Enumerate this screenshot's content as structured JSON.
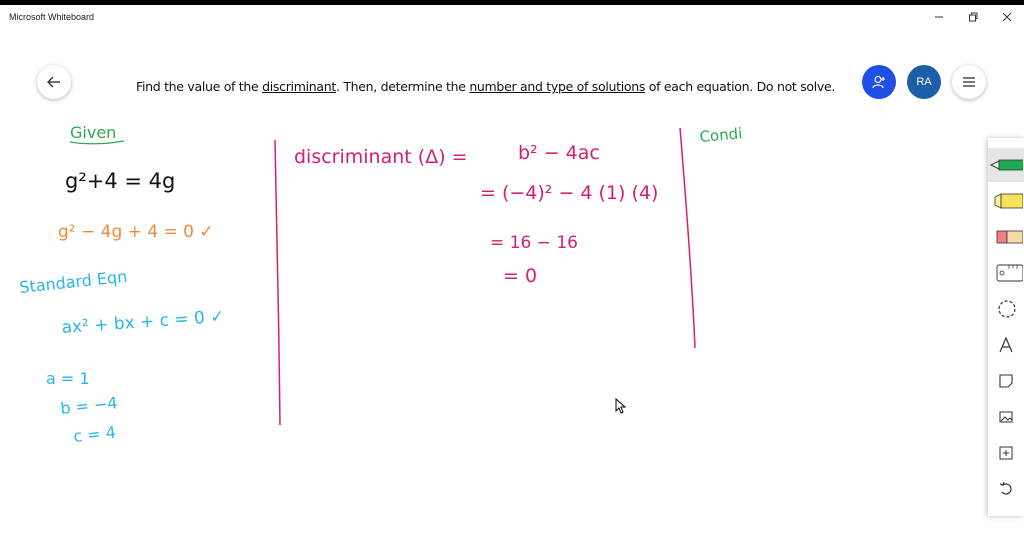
{
  "window": {
    "title": "Microsoft Whiteboard"
  },
  "header": {
    "back_icon": "back-arrow-icon",
    "question_parts": [
      {
        "text": "Find the value of the ",
        "underline": false
      },
      {
        "text": "discriminant",
        "underline": true
      },
      {
        "text": ". Then, determine the ",
        "underline": false
      },
      {
        "text": "number and type of solutions",
        "underline": true
      },
      {
        "text": " of each equation. Do not solve.",
        "underline": false
      }
    ],
    "user_initials": "RA"
  },
  "board": {
    "given_label": "Given",
    "eq1": "g²+4 = 4g",
    "eq2": "g² − 4g + 4 = 0 ✓",
    "std_label": "Standard Eqn",
    "std_eq": "ax² + bx + c = 0 ✓",
    "a_val": "a = 1",
    "b_val": "b = −4",
    "c_val": "c = 4",
    "disc_line1": "discriminant (Δ) =",
    "disc_formula": "b² − 4ac",
    "disc_line2": "= (−4)² − 4 (1) (4)",
    "disc_line3": "= 16 − 16",
    "disc_line4": "= 0",
    "cond_label": "Condi"
  },
  "colors": {
    "ink_black": "#111111",
    "ink_orange": "#f08a3a",
    "ink_cyan": "#29b6e6",
    "ink_pink": "#d61f6f",
    "ink_green": "#2eaa4f",
    "accent_blue": "#1f4fe6",
    "avatar_blue": "#1c5fa8"
  },
  "toolbar": {
    "tools": [
      "green-pen-icon",
      "highlighter-icon",
      "eraser-icon",
      "ruler-icon",
      "lasso-icon",
      "text-icon",
      "sticky-note-icon",
      "image-icon",
      "add-icon",
      "undo-icon"
    ]
  }
}
